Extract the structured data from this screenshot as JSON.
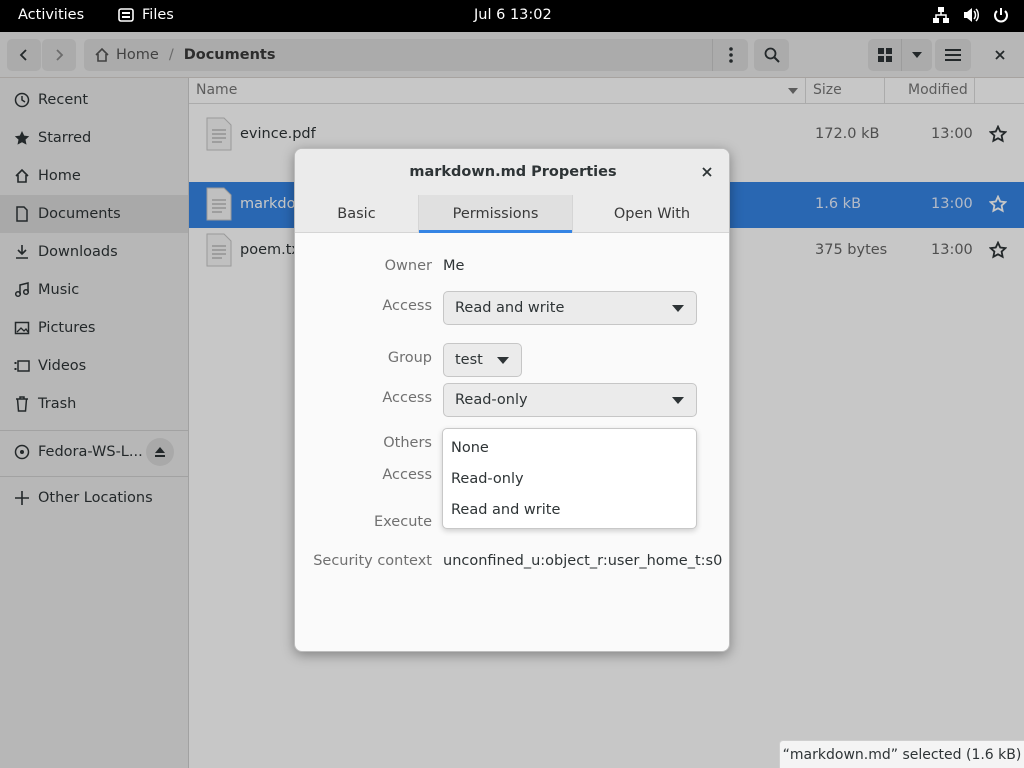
{
  "topbar": {
    "activities": "Activities",
    "app_name": "Files",
    "clock": "Jul 6  13:02"
  },
  "pathbar": {
    "home": "Home",
    "separator": "/",
    "current": "Documents"
  },
  "sidebar": {
    "items": [
      {
        "label": "Recent",
        "icon": "clock-icon"
      },
      {
        "label": "Starred",
        "icon": "star-icon"
      },
      {
        "label": "Home",
        "icon": "home-icon"
      },
      {
        "label": "Documents",
        "icon": "documents-icon"
      },
      {
        "label": "Downloads",
        "icon": "download-icon"
      },
      {
        "label": "Music",
        "icon": "music-icon"
      },
      {
        "label": "Pictures",
        "icon": "pictures-icon"
      },
      {
        "label": "Videos",
        "icon": "videos-icon"
      },
      {
        "label": "Trash",
        "icon": "trash-icon"
      }
    ],
    "device": "Fedora-WS-L...",
    "other": "Other Locations"
  },
  "list": {
    "columns": {
      "name": "Name",
      "size": "Size",
      "modified": "Modified"
    },
    "rows": [
      {
        "name": "evince.pdf",
        "size": "172.0 kB",
        "modified": "13:00"
      },
      {
        "name": "markdown.md",
        "size": "1.6 kB",
        "modified": "13:00"
      },
      {
        "name": "poem.txt",
        "size": "375 bytes",
        "modified": "13:00"
      }
    ]
  },
  "status": "“markdown.md” selected  (1.6 kB)",
  "dialog": {
    "title": "markdown.md Properties",
    "tabs": [
      "Basic",
      "Permissions",
      "Open With"
    ],
    "owner_label": "Owner",
    "owner_value": "Me",
    "access_label": "Access",
    "owner_access": "Read and write",
    "group_label": "Group",
    "group_value": "test",
    "group_access": "Read-only",
    "others_label": "Others",
    "execute_label": "Execute",
    "security_label": "Security context",
    "security_value": "unconfined_u:object_r:user_home_t:s0",
    "popover_options": [
      "None",
      "Read-only",
      "Read and write"
    ]
  },
  "colors": {
    "accent": "#3584e4",
    "topbar": "#000000"
  }
}
